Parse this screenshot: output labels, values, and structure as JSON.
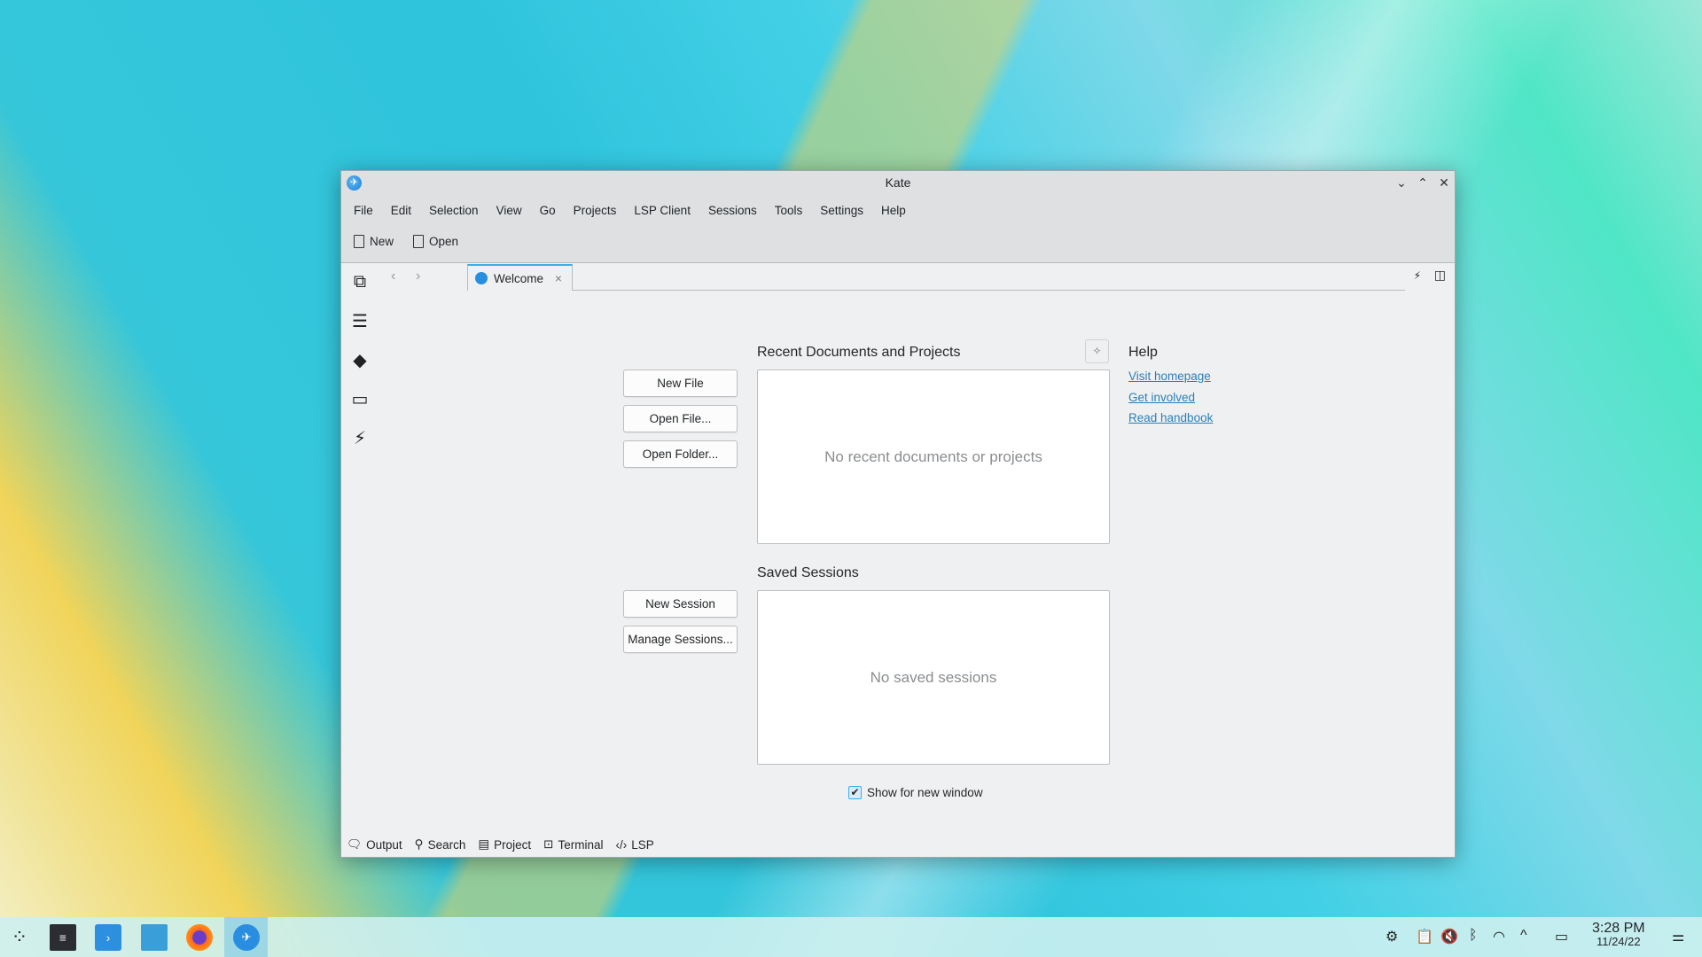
{
  "window": {
    "title": "Kate",
    "controls": [
      "minimize",
      "maximize",
      "close"
    ]
  },
  "menu": [
    "File",
    "Edit",
    "Selection",
    "View",
    "Go",
    "Projects",
    "LSP Client",
    "Sessions",
    "Tools",
    "Settings",
    "Help"
  ],
  "toolbar": {
    "new_label": "New",
    "open_label": "Open"
  },
  "tabs": [
    {
      "label": "Welcome",
      "active": true
    }
  ],
  "sidebar": {
    "icons": [
      "documents-icon",
      "symbols-list-icon",
      "git-icon",
      "folder-icon",
      "projects-icon"
    ]
  },
  "welcome": {
    "recent_heading": "Recent Documents and Projects",
    "recent_empty": "No recent documents or projects",
    "buttons": {
      "new_file": "New File",
      "open_file": "Open File...",
      "open_folder": "Open Folder...",
      "new_session": "New Session",
      "manage_sessions": "Manage Sessions..."
    },
    "sessions_heading": "Saved Sessions",
    "sessions_empty": "No saved sessions",
    "help_heading": "Help",
    "help_links": [
      "Visit homepage",
      "Get involved",
      "Read handbook"
    ],
    "show_for_new_window": {
      "label": "Show for new window",
      "checked": true
    }
  },
  "bottom_panel": [
    "Output",
    "Search",
    "Project",
    "Terminal",
    "LSP"
  ],
  "taskbar": {
    "apps": [
      "application-launcher",
      "system-settings",
      "discover",
      "dolphin",
      "firefox",
      "kate"
    ],
    "active": "kate",
    "clock": {
      "time": "3:28 PM",
      "date": "11/24/22"
    }
  },
  "colors": {
    "accent": "#3daee9",
    "link": "#2980b9"
  }
}
